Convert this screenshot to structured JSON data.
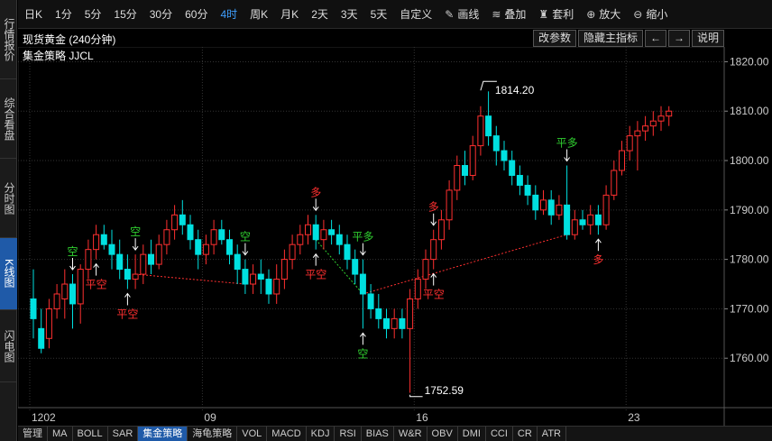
{
  "sidebar": {
    "tabs": [
      {
        "label": "行情报价",
        "active": false
      },
      {
        "label": "综合看盘",
        "active": false
      },
      {
        "label": "分时图",
        "active": false
      },
      {
        "label": "K线图",
        "active": true
      },
      {
        "label": "闪电图",
        "active": false
      }
    ]
  },
  "toolbar": {
    "periods": [
      {
        "label": "日K",
        "active": false
      },
      {
        "label": "1分",
        "active": false
      },
      {
        "label": "5分",
        "active": false
      },
      {
        "label": "15分",
        "active": false
      },
      {
        "label": "30分",
        "active": false
      },
      {
        "label": "60分",
        "active": false
      },
      {
        "label": "4时",
        "active": true
      },
      {
        "label": "周K",
        "active": false
      },
      {
        "label": "月K",
        "active": false
      },
      {
        "label": "2天",
        "active": false
      },
      {
        "label": "3天",
        "active": false
      },
      {
        "label": "5天",
        "active": false
      },
      {
        "label": "自定义",
        "active": false
      }
    ],
    "tools": [
      {
        "icon": "pencil-icon",
        "glyph": "✎",
        "label": "画线"
      },
      {
        "icon": "stack-icon",
        "glyph": "≋",
        "label": "叠加"
      },
      {
        "icon": "bag-icon",
        "glyph": "♜",
        "label": "套利"
      },
      {
        "icon": "zoom-in-icon",
        "glyph": "⊕",
        "label": "放大"
      },
      {
        "icon": "zoom-out-icon",
        "glyph": "⊖",
        "label": "缩小"
      }
    ]
  },
  "titlebar": {
    "title": "现货黄金 (240分钟)",
    "buttons": {
      "modify_params": "改参数",
      "hide_indicator": "隐藏主指标",
      "prev": "←",
      "next": "→",
      "help": "说明"
    }
  },
  "indicator_label": "集金策略 JJCL",
  "bottom_tabs": [
    {
      "label": "管理",
      "active": false
    },
    {
      "label": "MA",
      "active": false
    },
    {
      "label": "BOLL",
      "active": false
    },
    {
      "label": "SAR",
      "active": false
    },
    {
      "label": "集金策略",
      "active": true
    },
    {
      "label": "海龟策略",
      "active": false
    },
    {
      "label": "VOL",
      "active": false
    },
    {
      "label": "MACD",
      "active": false
    },
    {
      "label": "KDJ",
      "active": false
    },
    {
      "label": "RSI",
      "active": false
    },
    {
      "label": "BIAS",
      "active": false
    },
    {
      "label": "W&R",
      "active": false
    },
    {
      "label": "OBV",
      "active": false
    },
    {
      "label": "DMI",
      "active": false
    },
    {
      "label": "CCI",
      "active": false
    },
    {
      "label": "CR",
      "active": false
    },
    {
      "label": "ATR",
      "active": false
    }
  ],
  "chart_data": {
    "type": "candlestick",
    "ylim": [
      1750,
      1823
    ],
    "y_ticks": [
      1760,
      1770,
      1780,
      1790,
      1800,
      1810,
      1820
    ],
    "x_ticks": [
      {
        "index": 0,
        "label": "1202"
      },
      {
        "index": 22,
        "label": "09"
      },
      {
        "index": 49,
        "label": "16"
      },
      {
        "index": 76,
        "label": "23"
      }
    ],
    "colors": {
      "up": "#ff3030",
      "down": "#00e0e0",
      "grid": "#333333",
      "signal_dash_up": "#30d030",
      "signal_dash_down": "#ff3030"
    },
    "candles": [
      [
        1772,
        1768,
        1778,
        1764
      ],
      [
        1766,
        1762,
        1770,
        1761
      ],
      [
        1764,
        1770,
        1772,
        1762
      ],
      [
        1770,
        1773,
        1775,
        1768
      ],
      [
        1772,
        1775,
        1778,
        1768
      ],
      [
        1775,
        1771,
        1777,
        1766
      ],
      [
        1771,
        1778,
        1779,
        1767
      ],
      [
        1778,
        1782,
        1784,
        1776
      ],
      [
        1782,
        1785,
        1787,
        1780
      ],
      [
        1785,
        1783,
        1787,
        1782
      ],
      [
        1783,
        1781,
        1786,
        1778
      ],
      [
        1781,
        1778,
        1784,
        1776
      ],
      [
        1778,
        1776,
        1781,
        1774
      ],
      [
        1776,
        1777,
        1781,
        1774
      ],
      [
        1777,
        1781,
        1783,
        1775
      ],
      [
        1781,
        1779,
        1784,
        1777
      ],
      [
        1779,
        1783,
        1785,
        1778
      ],
      [
        1783,
        1786,
        1788,
        1781
      ],
      [
        1786,
        1789,
        1791,
        1784
      ],
      [
        1789,
        1787,
        1792,
        1785
      ],
      [
        1787,
        1784,
        1789,
        1782
      ],
      [
        1784,
        1781,
        1786,
        1778
      ],
      [
        1781,
        1783,
        1785,
        1779
      ],
      [
        1783,
        1786,
        1788,
        1781
      ],
      [
        1786,
        1784,
        1788,
        1783
      ],
      [
        1784,
        1781,
        1786,
        1779
      ],
      [
        1781,
        1778,
        1783,
        1775
      ],
      [
        1778,
        1775,
        1780,
        1773
      ],
      [
        1775,
        1777,
        1779,
        1773
      ],
      [
        1777,
        1776,
        1780,
        1773
      ],
      [
        1776,
        1773,
        1778,
        1771
      ],
      [
        1773,
        1776,
        1779,
        1771
      ],
      [
        1776,
        1780,
        1782,
        1774
      ],
      [
        1780,
        1783,
        1785,
        1778
      ],
      [
        1783,
        1785,
        1787,
        1781
      ],
      [
        1785,
        1787,
        1789,
        1783
      ],
      [
        1787,
        1784,
        1789,
        1782
      ],
      [
        1784,
        1786,
        1788,
        1782
      ],
      [
        1786,
        1785,
        1788,
        1783
      ],
      [
        1785,
        1783,
        1787,
        1781
      ],
      [
        1783,
        1780,
        1785,
        1778
      ],
      [
        1780,
        1777,
        1782,
        1775
      ],
      [
        1777,
        1773,
        1780,
        1766
      ],
      [
        1773,
        1770,
        1775,
        1768
      ],
      [
        1770,
        1768,
        1773,
        1766
      ],
      [
        1768,
        1766,
        1770,
        1764
      ],
      [
        1766,
        1768,
        1770,
        1764
      ],
      [
        1768,
        1766,
        1770,
        1764
      ],
      [
        1766,
        1772,
        1774,
        1753
      ],
      [
        1772,
        1776,
        1778,
        1770
      ],
      [
        1776,
        1780,
        1782,
        1774
      ],
      [
        1780,
        1784,
        1786,
        1778
      ],
      [
        1784,
        1788,
        1790,
        1782
      ],
      [
        1788,
        1794,
        1796,
        1786
      ],
      [
        1794,
        1799,
        1801,
        1792
      ],
      [
        1799,
        1797,
        1802,
        1795
      ],
      [
        1797,
        1803,
        1805,
        1796
      ],
      [
        1803,
        1809,
        1811,
        1801
      ],
      [
        1809,
        1805,
        1814,
        1803
      ],
      [
        1805,
        1802,
        1807,
        1799
      ],
      [
        1802,
        1800,
        1804,
        1798
      ],
      [
        1800,
        1797,
        1802,
        1795
      ],
      [
        1797,
        1795,
        1799,
        1793
      ],
      [
        1795,
        1793,
        1797,
        1791
      ],
      [
        1793,
        1790,
        1795,
        1788
      ],
      [
        1790,
        1792,
        1794,
        1789
      ],
      [
        1792,
        1789,
        1794,
        1787
      ],
      [
        1789,
        1791,
        1793,
        1788
      ],
      [
        1791,
        1785,
        1799,
        1784
      ],
      [
        1785,
        1788,
        1790,
        1784
      ],
      [
        1788,
        1787,
        1790,
        1786
      ],
      [
        1787,
        1789,
        1791,
        1785
      ],
      [
        1789,
        1787,
        1791,
        1785
      ],
      [
        1787,
        1793,
        1795,
        1786
      ],
      [
        1793,
        1798,
        1800,
        1792
      ],
      [
        1798,
        1802,
        1804,
        1797
      ],
      [
        1802,
        1805,
        1807,
        1800
      ],
      [
        1805,
        1806,
        1808,
        1798
      ],
      [
        1806,
        1807,
        1809,
        1804
      ],
      [
        1807,
        1808,
        1810,
        1805
      ],
      [
        1808,
        1809,
        1811,
        1806
      ],
      [
        1809,
        1810,
        1811,
        1807
      ]
    ],
    "signals": [
      {
        "index": 5,
        "label": "空",
        "arrow": "down",
        "color": "#30d030",
        "at": "high"
      },
      {
        "index": 8,
        "label": "平空",
        "arrow": "up",
        "color": "#ff3030",
        "at": "low"
      },
      {
        "index": 12,
        "label": "平空",
        "arrow": "up",
        "color": "#ff3030",
        "at": "low"
      },
      {
        "index": 13,
        "label": "空",
        "arrow": "down",
        "color": "#30d030",
        "at": "high"
      },
      {
        "index": 27,
        "label": "空",
        "arrow": "down",
        "color": "#30d030",
        "at": "high"
      },
      {
        "index": 36,
        "label": "多",
        "arrow": "down",
        "color": "#ff3030",
        "at": "high"
      },
      {
        "index": 36,
        "label": "平空",
        "arrow": "up",
        "color": "#ff3030",
        "at": "low"
      },
      {
        "index": 42,
        "label": "平多",
        "arrow": "down",
        "color": "#30d030",
        "at": "high"
      },
      {
        "index": 42,
        "label": "空",
        "arrow": "up",
        "color": "#30d030",
        "at": "low"
      },
      {
        "index": 51,
        "label": "多",
        "arrow": "down",
        "color": "#ff3030",
        "at": "high"
      },
      {
        "index": 51,
        "label": "平空",
        "arrow": "up",
        "color": "#ff3030",
        "at": "low"
      },
      {
        "index": 68,
        "label": "平多",
        "arrow": "down",
        "color": "#30d030",
        "at": "high"
      },
      {
        "index": 72,
        "label": "多",
        "arrow": "up",
        "color": "#ff3030",
        "at": "low"
      }
    ],
    "annotations": [
      {
        "index": 57,
        "value": 1814.2,
        "label": "1814.20"
      },
      {
        "index": 48,
        "value": 1752.59,
        "label": "1752.59"
      }
    ]
  }
}
